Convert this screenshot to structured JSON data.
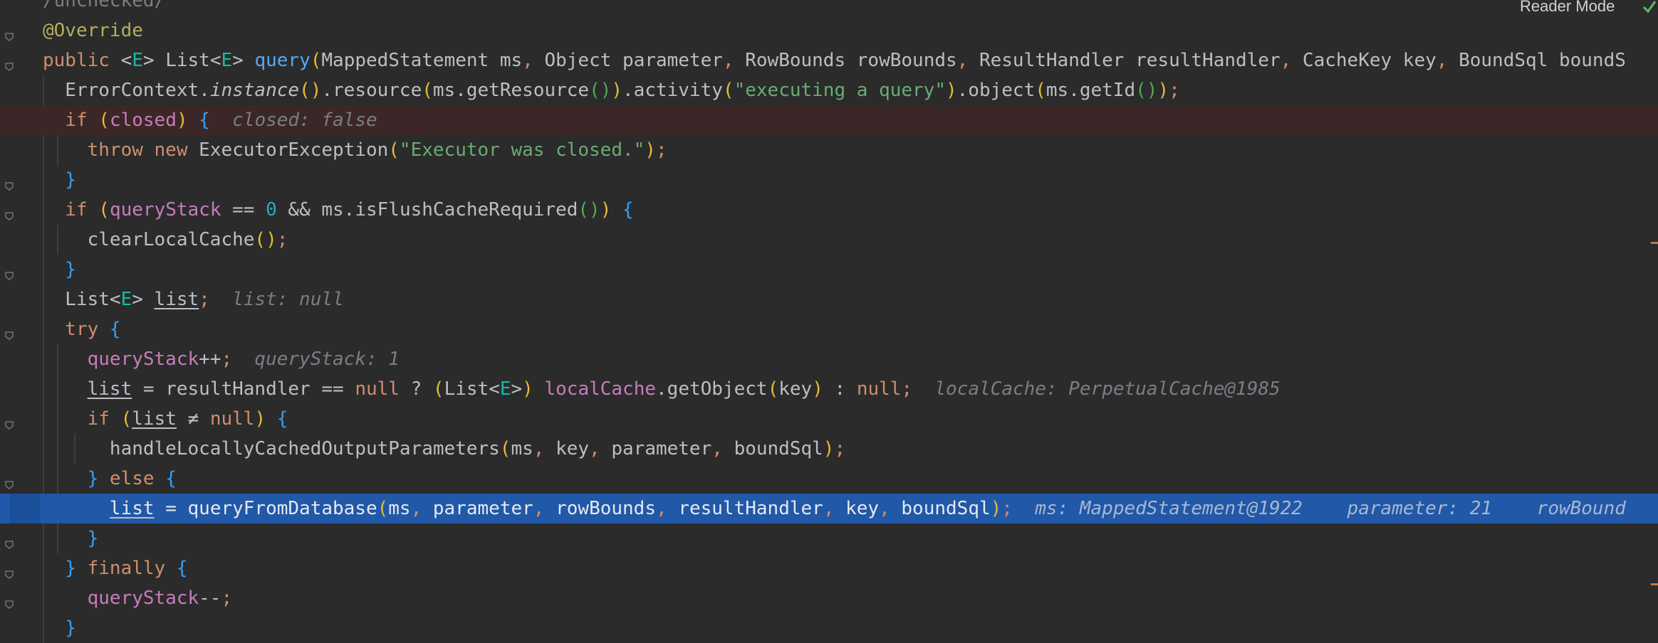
{
  "toolbar": {
    "reader_mode_label": "Reader Mode"
  },
  "lines": [
    {
      "id": "l0",
      "segments": [
        {
          "t": "/unchecked/",
          "c": "cmt"
        }
      ]
    },
    {
      "id": "l1",
      "segments": [
        {
          "t": "@Override",
          "c": "ann"
        }
      ]
    },
    {
      "id": "l2",
      "segments": [
        {
          "t": "public ",
          "c": "kw"
        },
        {
          "t": "<",
          "c": "par"
        },
        {
          "t": "E",
          "c": "tp"
        },
        {
          "t": "> ",
          "c": "par"
        },
        {
          "t": "List",
          "c": "par"
        },
        {
          "t": "<",
          "c": "par"
        },
        {
          "t": "E",
          "c": "tp"
        },
        {
          "t": "> ",
          "c": "par"
        },
        {
          "t": "query",
          "c": "fn"
        },
        {
          "t": "(",
          "c": "br1"
        },
        {
          "t": "MappedStatement ms",
          "c": "par"
        },
        {
          "t": ", ",
          "c": "kw"
        },
        {
          "t": "Object parameter",
          "c": "par"
        },
        {
          "t": ", ",
          "c": "kw"
        },
        {
          "t": "RowBounds rowBounds",
          "c": "par"
        },
        {
          "t": ", ",
          "c": "kw"
        },
        {
          "t": "ResultHandler resultHandler",
          "c": "par"
        },
        {
          "t": ", ",
          "c": "kw"
        },
        {
          "t": "CacheKey key",
          "c": "par"
        },
        {
          "t": ", ",
          "c": "kw"
        },
        {
          "t": "BoundSql boundS",
          "c": "par"
        }
      ]
    },
    {
      "id": "l3",
      "segments": [
        {
          "t": "  ErrorContext.",
          "c": "par"
        },
        {
          "t": "instance",
          "c": "it"
        },
        {
          "t": "()",
          "c": "br1"
        },
        {
          "t": ".resource",
          "c": "par"
        },
        {
          "t": "(",
          "c": "br1"
        },
        {
          "t": "ms.getResource",
          "c": "par"
        },
        {
          "t": "()",
          "c": "br2"
        },
        {
          "t": ")",
          "c": "br1"
        },
        {
          "t": ".activity",
          "c": "par"
        },
        {
          "t": "(",
          "c": "br1"
        },
        {
          "t": "\"executing a query\"",
          "c": "str"
        },
        {
          "t": ")",
          "c": "br1"
        },
        {
          "t": ".object",
          "c": "par"
        },
        {
          "t": "(",
          "c": "br1"
        },
        {
          "t": "ms.getId",
          "c": "par"
        },
        {
          "t": "()",
          "c": "br2"
        },
        {
          "t": ")",
          "c": "br1"
        },
        {
          "t": ";",
          "c": "kw"
        }
      ]
    },
    {
      "id": "l4",
      "bp": true,
      "segments": [
        {
          "t": "  if ",
          "c": "kw"
        },
        {
          "t": "(",
          "c": "br1"
        },
        {
          "t": "closed",
          "c": "fld"
        },
        {
          "t": ")",
          "c": "br1"
        },
        {
          "t": " {",
          "c": "br3"
        },
        {
          "t": "  closed: false",
          "c": "hint"
        }
      ]
    },
    {
      "id": "l5",
      "segments": [
        {
          "t": "    throw new ",
          "c": "kw"
        },
        {
          "t": "ExecutorException",
          "c": "par"
        },
        {
          "t": "(",
          "c": "br1"
        },
        {
          "t": "\"Executor was closed.\"",
          "c": "str"
        },
        {
          "t": ")",
          "c": "br1"
        },
        {
          "t": ";",
          "c": "kw"
        }
      ]
    },
    {
      "id": "l6",
      "segments": [
        {
          "t": "  }",
          "c": "br3"
        }
      ]
    },
    {
      "id": "l7",
      "segments": [
        {
          "t": "  if ",
          "c": "kw"
        },
        {
          "t": "(",
          "c": "br1"
        },
        {
          "t": "queryStack",
          "c": "fld"
        },
        {
          "t": " == ",
          "c": "par"
        },
        {
          "t": "0",
          "c": "num"
        },
        {
          "t": " && ms.isFlushCacheRequired",
          "c": "par"
        },
        {
          "t": "()",
          "c": "br2"
        },
        {
          "t": ")",
          "c": "br1"
        },
        {
          "t": " {",
          "c": "br3"
        }
      ]
    },
    {
      "id": "l8",
      "segments": [
        {
          "t": "    clearLocalCache",
          "c": "par"
        },
        {
          "t": "()",
          "c": "br1"
        },
        {
          "t": ";",
          "c": "kw"
        }
      ]
    },
    {
      "id": "l9",
      "segments": [
        {
          "t": "  }",
          "c": "br3"
        }
      ]
    },
    {
      "id": "l10",
      "segments": [
        {
          "t": "  List",
          "c": "par"
        },
        {
          "t": "<",
          "c": "par"
        },
        {
          "t": "E",
          "c": "tp"
        },
        {
          "t": "> ",
          "c": "par"
        },
        {
          "t": "list",
          "c": "ul"
        },
        {
          "t": ";",
          "c": "kw"
        },
        {
          "t": "  list: null",
          "c": "hint"
        }
      ]
    },
    {
      "id": "l11",
      "segments": [
        {
          "t": "  try ",
          "c": "kw"
        },
        {
          "t": "{",
          "c": "br3"
        }
      ]
    },
    {
      "id": "l12",
      "segments": [
        {
          "t": "    queryStack",
          "c": "fld"
        },
        {
          "t": "++",
          "c": "par"
        },
        {
          "t": ";",
          "c": "kw"
        },
        {
          "t": "  queryStack: 1",
          "c": "hint"
        }
      ]
    },
    {
      "id": "l13",
      "segments": [
        {
          "t": "    ",
          "c": "par"
        },
        {
          "t": "list",
          "c": "ul"
        },
        {
          "t": " = resultHandler == ",
          "c": "par"
        },
        {
          "t": "null",
          "c": "kw"
        },
        {
          "t": " ? ",
          "c": "par"
        },
        {
          "t": "(",
          "c": "br1"
        },
        {
          "t": "List",
          "c": "par"
        },
        {
          "t": "<",
          "c": "par"
        },
        {
          "t": "E",
          "c": "tp"
        },
        {
          "t": ">",
          "c": "par"
        },
        {
          "t": ")",
          "c": "br1"
        },
        {
          "t": " localCache",
          "c": "fld"
        },
        {
          "t": ".getObject",
          "c": "par"
        },
        {
          "t": "(",
          "c": "br1"
        },
        {
          "t": "key",
          "c": "par"
        },
        {
          "t": ")",
          "c": "br1"
        },
        {
          "t": " : ",
          "c": "par"
        },
        {
          "t": "null",
          "c": "kw"
        },
        {
          "t": ";",
          "c": "kw"
        },
        {
          "t": "  localCache: PerpetualCache@1985",
          "c": "hint"
        }
      ]
    },
    {
      "id": "l14",
      "segments": [
        {
          "t": "    if ",
          "c": "kw"
        },
        {
          "t": "(",
          "c": "br1"
        },
        {
          "t": "list",
          "c": "ul"
        },
        {
          "t": " ≠ ",
          "c": "par"
        },
        {
          "t": "null",
          "c": "kw"
        },
        {
          "t": ")",
          "c": "br1"
        },
        {
          "t": " {",
          "c": "br3"
        }
      ]
    },
    {
      "id": "l15",
      "segments": [
        {
          "t": "      handleLocallyCachedOutputParameters",
          "c": "par"
        },
        {
          "t": "(",
          "c": "br1"
        },
        {
          "t": "ms",
          "c": "par"
        },
        {
          "t": ", ",
          "c": "kw"
        },
        {
          "t": "key",
          "c": "par"
        },
        {
          "t": ", ",
          "c": "kw"
        },
        {
          "t": "parameter",
          "c": "par"
        },
        {
          "t": ", ",
          "c": "kw"
        },
        {
          "t": "boundSql",
          "c": "par"
        },
        {
          "t": ")",
          "c": "br1"
        },
        {
          "t": ";",
          "c": "kw"
        }
      ]
    },
    {
      "id": "l16",
      "segments": [
        {
          "t": "    } ",
          "c": "br3"
        },
        {
          "t": "else ",
          "c": "kw"
        },
        {
          "t": "{",
          "c": "br3"
        }
      ]
    },
    {
      "id": "l17",
      "exec": true,
      "segments": [
        {
          "t": "      ",
          "c": "par"
        },
        {
          "t": "list",
          "c": "ul"
        },
        {
          "t": " = queryFromDatabase",
          "c": "par"
        },
        {
          "t": "(",
          "c": "br1"
        },
        {
          "t": "ms",
          "c": "par"
        },
        {
          "t": ", ",
          "c": "kw"
        },
        {
          "t": "parameter",
          "c": "par"
        },
        {
          "t": ", ",
          "c": "kw"
        },
        {
          "t": "rowBounds",
          "c": "par"
        },
        {
          "t": ", ",
          "c": "kw"
        },
        {
          "t": "resultHandler",
          "c": "par"
        },
        {
          "t": ", ",
          "c": "kw"
        },
        {
          "t": "key",
          "c": "par"
        },
        {
          "t": ", ",
          "c": "kw"
        },
        {
          "t": "boundSql",
          "c": "par"
        },
        {
          "t": ")",
          "c": "br1"
        },
        {
          "t": ";",
          "c": "kw"
        },
        {
          "t": "  ms: MappedStatement@1922    parameter: 21    rowBound",
          "c": "hint"
        }
      ]
    },
    {
      "id": "l18",
      "segments": [
        {
          "t": "    }",
          "c": "br3"
        }
      ]
    },
    {
      "id": "l19",
      "segments": [
        {
          "t": "  } ",
          "c": "br3"
        },
        {
          "t": "finally ",
          "c": "kw"
        },
        {
          "t": "{",
          "c": "br3"
        }
      ]
    },
    {
      "id": "l20",
      "segments": [
        {
          "t": "    queryStack",
          "c": "fld"
        },
        {
          "t": "--",
          "c": "par"
        },
        {
          "t": ";",
          "c": "kw"
        }
      ]
    },
    {
      "id": "l21",
      "segments": [
        {
          "t": "  }",
          "c": "br3"
        }
      ]
    }
  ],
  "colors": {
    "background": "#2b2b2b",
    "execution_highlight": "#2158a8",
    "breakpoint_line": "#3b2727",
    "keyword": "#cf8e6d",
    "string": "#6aab73",
    "field": "#c77dbb"
  }
}
